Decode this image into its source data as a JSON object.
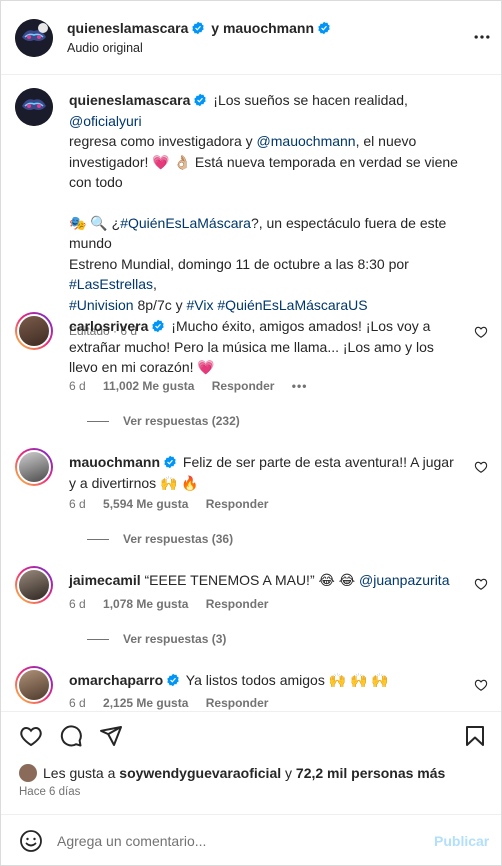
{
  "header": {
    "user1": "quieneslamascara",
    "connector": "y",
    "user2": "mauochmann",
    "subtitle": "Audio original",
    "more_icon": "more-horizontal-icon"
  },
  "caption": {
    "username": "quieneslamascara",
    "line1_a": "¡Los sueños se hacen realidad,",
    "mention1": "@oficialyuri",
    "line2_a": "regresa como investigadora y",
    "mention2": "@mauochmann",
    "line2_b": ", el nuevo",
    "line3": "investigador! 💗 👌🏼  Está nueva temporada en verdad se viene",
    "line4": "con todo",
    "emoji_line": "🎭 🔍 ¿",
    "hashtag1": "#QuiénEsLaMáscara",
    "line5_b": "?, un espectáculo fuera de este",
    "line6": "mundo",
    "line7": "Estreno Mundial, domingo 11 de octubre a las 8:30 por",
    "hashtag2": "#LasEstrellas",
    "hashtag2_suffix": ",",
    "hashtag3": "#Univision",
    "line9_mid": " 8p/7c y ",
    "hashtag4": "#Vix",
    "hashtag5": "#QuiénEsLaMáscaraUS",
    "edited": "Editado · 6 d"
  },
  "comments": [
    {
      "username": "carlosrivera",
      "text": "¡Mucho éxito, amigos amados! ¡Los voy a extrañar mucho! Pero la música me llama... ¡Los amo y los llevo en mi corazón! 💗",
      "time": "6 d",
      "likes": "11,002 Me gusta",
      "reply": "Responder",
      "replies": "Ver respuestas (232)"
    },
    {
      "username": "mauochmann",
      "text": "Feliz de ser parte de esta aventura!! A jugar y a divertirnos 🙌 🔥",
      "time": "6 d",
      "likes": "5,594 Me gusta",
      "reply": "Responder",
      "replies": "Ver respuestas (36)"
    },
    {
      "username": "jaimecamil",
      "text": "“EEEE TENEMOS A MAU!” 😂 😂",
      "mention": "@juanpazurita",
      "time": "6 d",
      "likes": "1,078 Me gusta",
      "reply": "Responder",
      "replies": "Ver respuestas (3)"
    },
    {
      "username": "omarchaparro",
      "text": "Ya listos todos amigos 🙌 🙌 🙌",
      "time": "6 d",
      "likes": "2,125 Me gusta",
      "reply": "Responder"
    }
  ],
  "footer": {
    "likes_prefix": "Les gusta a",
    "likes_user": "soywendyguevaraoficial",
    "likes_mid": " y ",
    "likes_count": "72,2 mil personas más",
    "time": "Hace 6 días",
    "comment_placeholder": "Agrega un comentario...",
    "post_label": "Publicar"
  },
  "colors": {
    "link": "#00376b",
    "verified": "#0095f6",
    "heart": "#ed4956",
    "secondary": "#737373",
    "post_disabled": "#b2dffc"
  }
}
